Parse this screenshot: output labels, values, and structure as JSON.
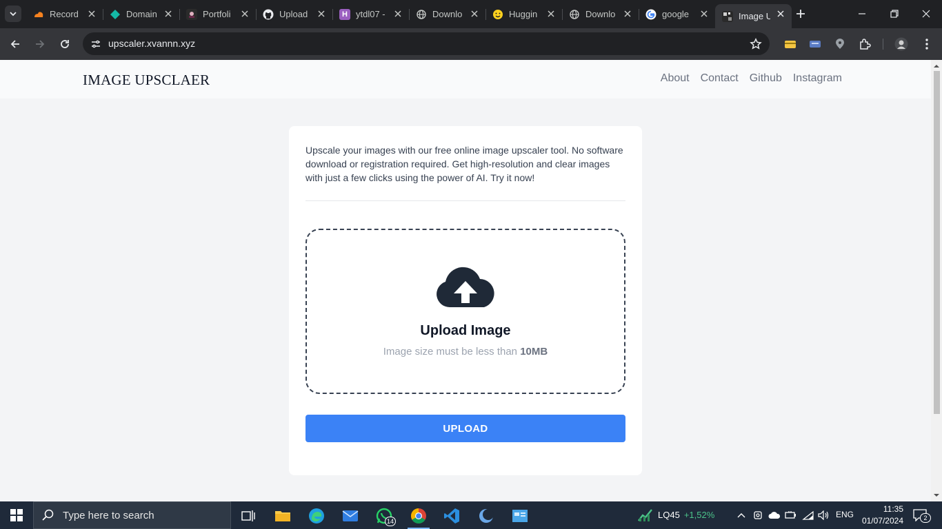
{
  "browser": {
    "tabs": [
      {
        "title": "Record",
        "icon": "cloudflare-icon"
      },
      {
        "title": "Domain",
        "icon": "domain-icon"
      },
      {
        "title": "Portfoli",
        "icon": "portfolio-icon"
      },
      {
        "title": "Upload",
        "icon": "github-icon"
      },
      {
        "title": "ytdl07 -",
        "icon": "huggingface-space-icon"
      },
      {
        "title": "Downlo",
        "icon": "globe-icon"
      },
      {
        "title": "Huggin",
        "icon": "huggingface-icon"
      },
      {
        "title": "Downlo",
        "icon": "globe-icon"
      },
      {
        "title": "google",
        "icon": "google-icon"
      },
      {
        "title": "Image U",
        "icon": "site-favicon-icon",
        "active": true
      }
    ],
    "url": "upscaler.xvannn.xyz"
  },
  "site": {
    "brand": "IMAGE UPSCLAER",
    "nav": [
      "About",
      "Contact",
      "Github",
      "Instagram"
    ],
    "intro": "Upscale your images with our free online image upscaler tool. No software download or registration required. Get high-resolution and clear images with just a few clicks using the power of AI. Try it now!",
    "upload_title": "Upload Image",
    "upload_hint_prefix": "Image size must be less than",
    "upload_hint_limit": "10MB",
    "upload_button": "UPLOAD",
    "colors": {
      "primary": "#3b82f6",
      "background": "#f3f4f6",
      "card": "#ffffff"
    }
  },
  "taskbar": {
    "search_placeholder": "Type here to search",
    "whatsapp_badge": "14",
    "stock_name": "LQ45",
    "stock_change": "+1,52%",
    "language": "ENG",
    "time": "11:35",
    "date": "01/07/2024",
    "notifications": "2"
  }
}
